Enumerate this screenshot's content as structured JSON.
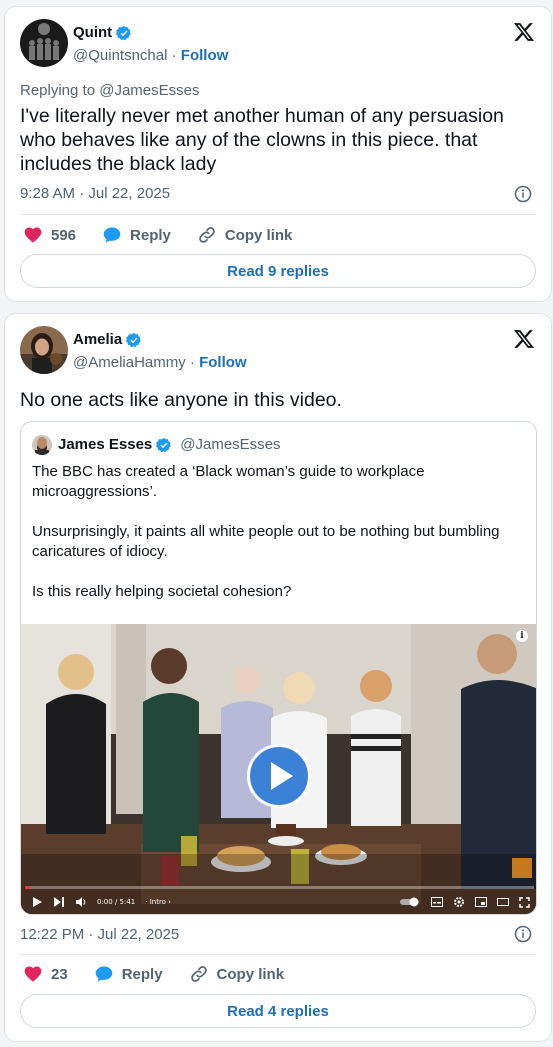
{
  "tweets": [
    {
      "author": {
        "name": "Quint",
        "handle": "@Quintsnchal",
        "follow": "Follow"
      },
      "replying_to": "Replying to @JamesEsses",
      "text": "I've literally never met another human of any persuasion who behaves like any of the clowns in this piece.  that includes the black lady",
      "timestamp": "9:28 AM · Jul 22, 2025",
      "likes": "596",
      "reply_label": "Reply",
      "copy_label": "Copy link",
      "read_replies": "Read 9 replies"
    },
    {
      "author": {
        "name": "Amelia",
        "handle": "@AmeliaHammy",
        "follow": "Follow"
      },
      "text": "No one acts like anyone in this video.",
      "quote": {
        "name": "James Esses",
        "handle": "@JamesEsses",
        "paragraphs": [
          "The BBC has created a ‘Black woman’s guide to workplace microaggressions’.",
          "Unsurprisingly, it paints all white people out to be nothing but bumbling caricatures of idiocy.",
          "Is this really helping societal cohesion?"
        ],
        "video": {
          "time": "0:00 / 5:41",
          "chapter": "· Intro ›",
          "progress": 0.01
        }
      },
      "timestamp": "12:22 PM · Jul 22, 2025",
      "likes": "23",
      "reply_label": "Reply",
      "copy_label": "Copy link",
      "read_replies": "Read 4 replies"
    }
  ],
  "colors": {
    "like": "#e0245e",
    "link": "#1d6fb8",
    "verified": "#1d9bf0"
  },
  "icons": [
    "verified-badge-icon",
    "x-logo-icon",
    "info-icon",
    "heart-icon",
    "reply-bubble-icon",
    "link-icon",
    "play-icon"
  ]
}
